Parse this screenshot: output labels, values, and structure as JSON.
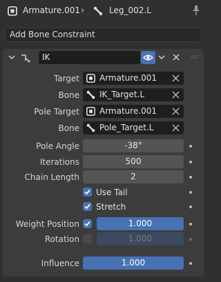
{
  "header": {
    "armature": "Armature.001",
    "bone": "Leg_002.L",
    "icons": [
      "armature-icon",
      "chevron-right-icon",
      "bone-icon",
      "pin-icon"
    ]
  },
  "add_constraint_label": "Add Bone Constraint",
  "constraint": {
    "name": "IK",
    "target": {
      "label": "Target",
      "value": "Armature.001"
    },
    "bone": {
      "label": "Bone",
      "value": "IK_Target.L"
    },
    "pole_target": {
      "label": "Pole Target",
      "value": "Armature.001"
    },
    "pole_bone": {
      "label": "Bone",
      "value": "Pole_Target.L"
    },
    "pole_angle": {
      "label": "Pole Angle",
      "value": "-38°"
    },
    "iterations": {
      "label": "Iterations",
      "value": "500"
    },
    "chain_length": {
      "label": "Chain Length",
      "value": "2"
    },
    "use_tail": {
      "label": "Use Tail",
      "checked": true
    },
    "stretch": {
      "label": "Stretch",
      "checked": true
    },
    "weight_position": {
      "label": "Weight Position",
      "checked": true,
      "value": "1.000"
    },
    "rotation": {
      "label": "Rotation",
      "checked": false,
      "value": "1.000"
    },
    "influence": {
      "label": "Influence",
      "value": "1.000"
    }
  },
  "colors": {
    "accent": "#4772b3",
    "panel": "#3c3c3c",
    "background": "#303030",
    "field": "#1e1e1e"
  }
}
